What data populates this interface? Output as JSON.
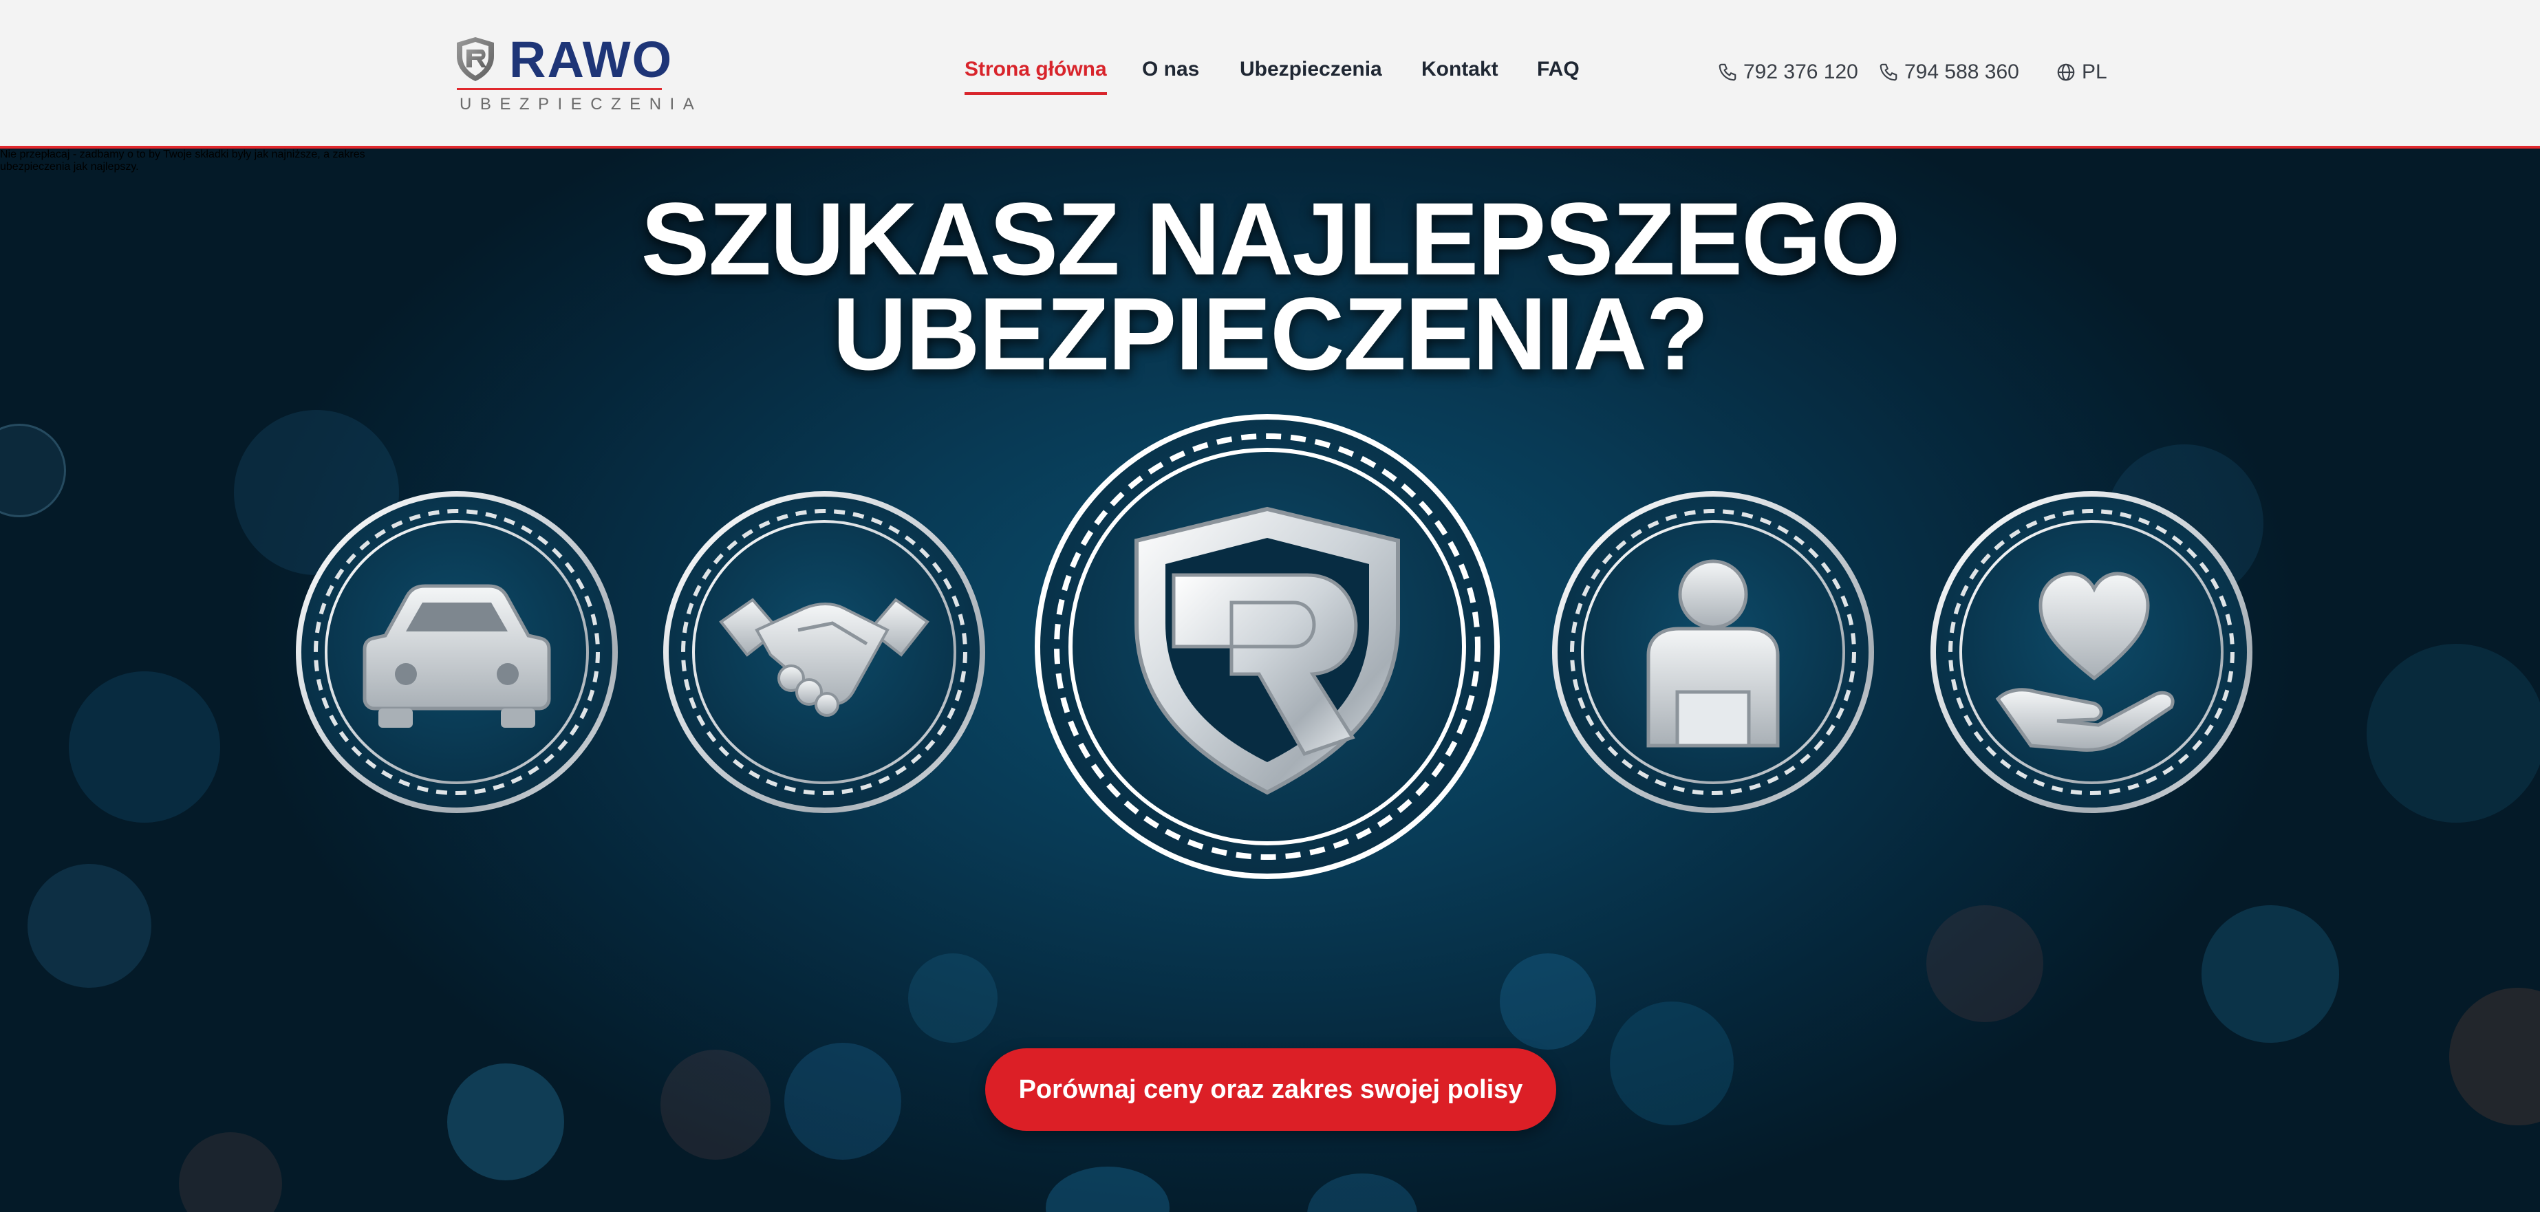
{
  "brand": {
    "name": "RAWO",
    "tagline": "UBEZPIECZENIA",
    "colors": {
      "navy": "#1e3577",
      "red": "#e0282d"
    }
  },
  "nav": {
    "items": [
      {
        "label": "Strona główna",
        "active": true
      },
      {
        "label": "O nas",
        "active": false
      },
      {
        "label": "Ubezpieczenia",
        "active": false
      },
      {
        "label": "Kontakt",
        "active": false
      },
      {
        "label": "FAQ",
        "active": false
      }
    ]
  },
  "contact": {
    "phone1": {
      "icon": "phone-icon",
      "number": "792 376 120"
    },
    "phone2": {
      "icon": "phone-icon",
      "number": "794 588 360"
    },
    "language": {
      "icon": "globe-icon",
      "code": "PL"
    }
  },
  "hero": {
    "title_line1": "SZUKASZ NAJLEPSZEGO",
    "title_line2": "UBEZPIECZENIA?",
    "emblems": [
      "car-icon",
      "handshake-icon",
      "rawo-shield-icon",
      "person-icon",
      "heart-hand-icon"
    ],
    "description_line1": "Nie przepłacaj - zadbamy o to by Twoje składki były jak najniższe, a zakres",
    "description_line2": "ubezpieczenia jak najlepszy.",
    "cta_label": "Porównaj ceny oraz zakres swojej polisy",
    "cta_color": "#dc1f26"
  }
}
